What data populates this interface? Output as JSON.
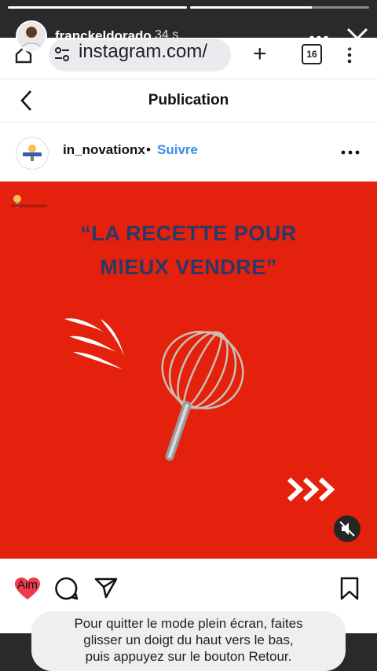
{
  "story": {
    "username": "franckeldorado",
    "time": "34 s",
    "progress_fill": [
      1.0,
      0.68
    ]
  },
  "browser": {
    "url": "instagram.com/",
    "tab_count": "16"
  },
  "page": {
    "title": "Publication"
  },
  "post": {
    "username": "in_novationx",
    "separator": "•",
    "follow_label": "Suivre",
    "headline_line1": "“LA RECETTE POUR",
    "headline_line2": "MIEUX VENDRE”",
    "likes_partial": "Aim",
    "colors": {
      "background": "#e3210d",
      "headline": "#2a3a66",
      "like": "#ed3c4d"
    }
  },
  "toast": {
    "line1": "Pour quitter le mode plein écran, faites",
    "line2": "glisser un doigt du haut vers le bas,",
    "line3": "puis appuyez sur le bouton Retour."
  },
  "icons": [
    "close-icon",
    "more-icon",
    "home-icon",
    "tune-icon",
    "plus-icon",
    "tabs-icon",
    "menu-icon",
    "back-icon",
    "heart-icon",
    "comment-icon",
    "share-icon",
    "bookmark-icon",
    "mute-icon",
    "whisk-icon",
    "arrows-icon"
  ]
}
